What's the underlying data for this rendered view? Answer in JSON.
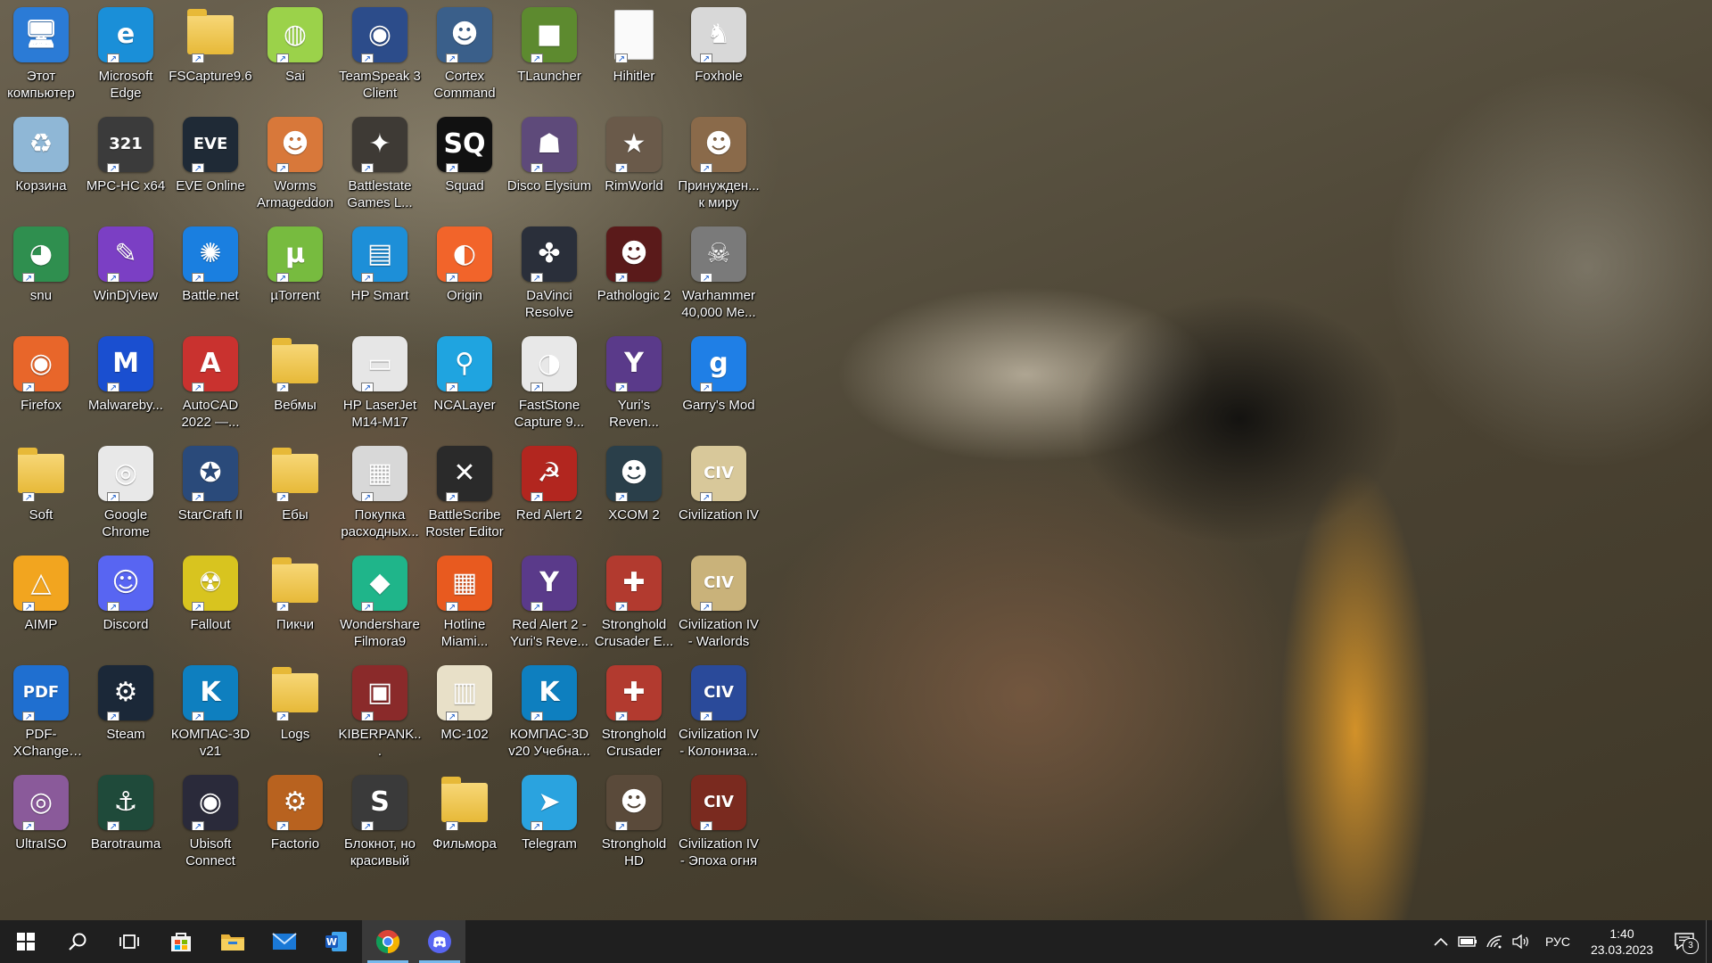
{
  "desktop": {
    "icons": [
      {
        "label": "Этот компьютер",
        "icon": "this-pc-icon",
        "color": "#2b7bd6",
        "glyph": "🖥",
        "shortcut": false
      },
      {
        "label": "Microsoft Edge",
        "icon": "edge-icon",
        "color": "#1a8fd8",
        "glyph": "e",
        "shortcut": true
      },
      {
        "label": "FSCapture9.6",
        "icon": "folder-icon",
        "color": "#e7b938",
        "glyph": "",
        "shortcut": true,
        "folder": true
      },
      {
        "label": "Sai",
        "icon": "sai-icon",
        "color": "#9bd24a",
        "glyph": "◍",
        "shortcut": true
      },
      {
        "label": "TeamSpeak 3 Client",
        "icon": "teamspeak-icon",
        "color": "#2c4c8a",
        "glyph": "◉",
        "shortcut": true
      },
      {
        "label": "Cortex Command",
        "icon": "cortex-command-icon",
        "color": "#3a5f8a",
        "glyph": "☻",
        "shortcut": true
      },
      {
        "label": "TLauncher",
        "icon": "tlauncher-icon",
        "color": "#5d8a2f",
        "glyph": "■",
        "shortcut": true
      },
      {
        "label": "Hihitler",
        "icon": "document-icon",
        "color": "#f2f2f2",
        "glyph": "",
        "shortcut": true,
        "doc": true
      },
      {
        "label": "Foxhole",
        "icon": "foxhole-icon",
        "color": "#d8d8d8",
        "glyph": "♞",
        "shortcut": true
      },
      {
        "label": "Корзина",
        "icon": "recycle-bin-icon",
        "color": "#8fb7d6",
        "glyph": "♻",
        "shortcut": false
      },
      {
        "label": "MPC-HC x64",
        "icon": "mpc-hc-icon",
        "color": "#3b3b3b",
        "glyph": "321",
        "shortcut": true
      },
      {
        "label": "EVE Online",
        "icon": "eve-online-icon",
        "color": "#1f2a36",
        "glyph": "EVE",
        "shortcut": true
      },
      {
        "label": "Worms Armageddon",
        "icon": "worms-icon",
        "color": "#d8783a",
        "glyph": "☻",
        "shortcut": true
      },
      {
        "label": "Battlestate Games L...",
        "icon": "battlestate-icon",
        "color": "#3e3a35",
        "glyph": "✦",
        "shortcut": true
      },
      {
        "label": "Squad",
        "icon": "squad-icon",
        "color": "#111111",
        "glyph": "SQ",
        "shortcut": true
      },
      {
        "label": "Disco Elysium",
        "icon": "disco-elysium-icon",
        "color": "#5e4a7a",
        "glyph": "☗",
        "shortcut": true
      },
      {
        "label": "RimWorld",
        "icon": "rimworld-icon",
        "color": "#6a5a4a",
        "glyph": "★",
        "shortcut": true
      },
      {
        "label": "Принужден... к миру",
        "icon": "game-icon",
        "color": "#8a6a4a",
        "glyph": "☻",
        "shortcut": true
      },
      {
        "label": "snu",
        "icon": "snu-icon",
        "color": "#2f8f4f",
        "glyph": "◕",
        "shortcut": true
      },
      {
        "label": "WinDjView",
        "icon": "windjview-icon",
        "color": "#7b3fc4",
        "glyph": "✎",
        "shortcut": true
      },
      {
        "label": "Battle.net",
        "icon": "battlenet-icon",
        "color": "#1a7fe0",
        "glyph": "✺",
        "shortcut": true
      },
      {
        "label": "µTorrent",
        "icon": "utorrent-icon",
        "color": "#77bb3f",
        "glyph": "µ",
        "shortcut": true
      },
      {
        "label": "HP Smart",
        "icon": "hp-smart-icon",
        "color": "#1d8fd8",
        "glyph": "▤",
        "shortcut": true
      },
      {
        "label": "Origin",
        "icon": "origin-icon",
        "color": "#f2642a",
        "glyph": "◐",
        "shortcut": true
      },
      {
        "label": "DaVinci Resolve",
        "icon": "davinci-resolve-icon",
        "color": "#2a2f3a",
        "glyph": "✤",
        "shortcut": true
      },
      {
        "label": "Pathologic 2",
        "icon": "pathologic-icon",
        "color": "#5a1a1a",
        "glyph": "☻",
        "shortcut": true
      },
      {
        "label": "Warhammer 40,000 Me...",
        "icon": "warhammer-icon",
        "color": "#7a7a7a",
        "glyph": "☠",
        "shortcut": true
      },
      {
        "label": "Firefox",
        "icon": "firefox-icon",
        "color": "#e8662a",
        "glyph": "◉",
        "shortcut": true
      },
      {
        "label": "Malwareby...",
        "icon": "malwarebytes-icon",
        "color": "#1a4fd0",
        "glyph": "M",
        "shortcut": true
      },
      {
        "label": "AutoCAD 2022 —...",
        "icon": "autocad-icon",
        "color": "#c9322f",
        "glyph": "A",
        "shortcut": true
      },
      {
        "label": "Вебмы",
        "icon": "folder-icon",
        "color": "#e7b938",
        "glyph": "",
        "shortcut": true,
        "folder": true
      },
      {
        "label": "HP LaserJet M14-M17",
        "icon": "printer-icon",
        "color": "#e6e6e6",
        "glyph": "▭",
        "shortcut": true
      },
      {
        "label": "NCALayer",
        "icon": "ncalayer-icon",
        "color": "#1fa4e0",
        "glyph": "⚲",
        "shortcut": true
      },
      {
        "label": "FastStone Capture 9...",
        "icon": "faststone-icon",
        "color": "#e8e8e8",
        "glyph": "◑",
        "shortcut": true
      },
      {
        "label": "Yuri's Reven...",
        "icon": "yuris-revenge-icon",
        "color": "#5a3a8a",
        "glyph": "Y",
        "shortcut": true
      },
      {
        "label": "Garry's Mod",
        "icon": "garrys-mod-icon",
        "color": "#1f7fe6",
        "glyph": "g",
        "shortcut": true
      },
      {
        "label": "Soft",
        "icon": "folder-icon",
        "color": "#e7b938",
        "glyph": "",
        "shortcut": true,
        "folder": true
      },
      {
        "label": "Google Chrome",
        "icon": "chrome-icon",
        "color": "#e8e8e8",
        "glyph": "◎",
        "shortcut": true
      },
      {
        "label": "StarCraft II",
        "icon": "starcraft-icon",
        "color": "#2a4a7a",
        "glyph": "✪",
        "shortcut": true
      },
      {
        "label": "Ебы",
        "icon": "folder-icon",
        "color": "#e7b938",
        "glyph": "",
        "shortcut": true,
        "folder": true
      },
      {
        "label": "Покупка расходных...",
        "icon": "printer-ink-icon",
        "color": "#d8d8d8",
        "glyph": "▦",
        "shortcut": true
      },
      {
        "label": "BattleScribe Roster Editor",
        "icon": "battlescribe-icon",
        "color": "#2a2a2a",
        "glyph": "✕",
        "shortcut": true
      },
      {
        "label": "Red Alert 2",
        "icon": "red-alert-icon",
        "color": "#b2261f",
        "glyph": "☭",
        "shortcut": true
      },
      {
        "label": "XCOM 2",
        "icon": "xcom-icon",
        "color": "#2a3f4a",
        "glyph": "☻",
        "shortcut": true
      },
      {
        "label": "Civilization IV",
        "icon": "civilization-icon",
        "color": "#d8c89a",
        "glyph": "CIV",
        "shortcut": true
      },
      {
        "label": "AIMP",
        "icon": "aimp-icon",
        "color": "#f2a51f",
        "glyph": "△",
        "shortcut": true
      },
      {
        "label": "Discord",
        "icon": "discord-icon",
        "color": "#5865f2",
        "glyph": "☺",
        "shortcut": true
      },
      {
        "label": "Fallout",
        "icon": "fallout-icon",
        "color": "#d8c41f",
        "glyph": "☢",
        "shortcut": true
      },
      {
        "label": "Пикчи",
        "icon": "folder-icon",
        "color": "#e7b938",
        "glyph": "",
        "shortcut": true,
        "folder": true
      },
      {
        "label": "Wondershare Filmora9",
        "icon": "filmora-icon",
        "color": "#1fb58a",
        "glyph": "◆",
        "shortcut": true
      },
      {
        "label": "Hotline Miami...",
        "icon": "hotline-miami-icon",
        "color": "#e85a1f",
        "glyph": "▦",
        "shortcut": true
      },
      {
        "label": "Red Alert 2 - Yuri's Reve...",
        "icon": "yuris-revenge-icon",
        "color": "#5a3a8a",
        "glyph": "Y",
        "shortcut": true
      },
      {
        "label": "Stronghold Crusader E...",
        "icon": "stronghold-icon",
        "color": "#b23a2f",
        "glyph": "✚",
        "shortcut": true
      },
      {
        "label": "Civilization IV - Warlords",
        "icon": "civilization-icon",
        "color": "#c9b27a",
        "glyph": "CIV",
        "shortcut": true
      },
      {
        "label": "PDF-XChange Viewer",
        "icon": "pdf-xchange-icon",
        "color": "#1f6fd0",
        "glyph": "PDF",
        "shortcut": true
      },
      {
        "label": "Steam",
        "icon": "steam-icon",
        "color": "#1b2838",
        "glyph": "⚙",
        "shortcut": true
      },
      {
        "label": "КОМПАС-3D v21",
        "icon": "kompas-icon",
        "color": "#0e7fbf",
        "glyph": "K",
        "shortcut": true
      },
      {
        "label": "Logs",
        "icon": "folder-icon",
        "color": "#e7b938",
        "glyph": "",
        "shortcut": true,
        "folder": true
      },
      {
        "label": "KIBERPANK...",
        "icon": "cyberpunk-icon",
        "color": "#8a2a2a",
        "glyph": "▣",
        "shortcut": true
      },
      {
        "label": "MC-102",
        "icon": "archive-icon",
        "color": "#e8e0c8",
        "glyph": "▥",
        "shortcut": true
      },
      {
        "label": "КОМПАС-3D v20 Учебна...",
        "icon": "kompas-icon",
        "color": "#0e7fbf",
        "glyph": "K",
        "shortcut": true
      },
      {
        "label": "Stronghold Crusader",
        "icon": "stronghold-icon",
        "color": "#b23a2f",
        "glyph": "✚",
        "shortcut": true
      },
      {
        "label": "Civilization IV - Колониза...",
        "icon": "civilization-icon",
        "color": "#2a4a9a",
        "glyph": "CIV",
        "shortcut": true
      },
      {
        "label": "UltraISO",
        "icon": "ultraiso-icon",
        "color": "#8a5a9a",
        "glyph": "◎",
        "shortcut": true
      },
      {
        "label": "Barotrauma",
        "icon": "barotrauma-icon",
        "color": "#1f4a3a",
        "glyph": "⚓",
        "shortcut": true
      },
      {
        "label": "Ubisoft Connect",
        "icon": "ubisoft-icon",
        "color": "#2a2a3a",
        "glyph": "◉",
        "shortcut": true
      },
      {
        "label": "Factorio",
        "icon": "factorio-icon",
        "color": "#b8621f",
        "glyph": "⚙",
        "shortcut": true
      },
      {
        "label": "Блокнот, но красивый",
        "icon": "sublime-icon",
        "color": "#3a3a3a",
        "glyph": "S",
        "shortcut": true
      },
      {
        "label": "Фильмора",
        "icon": "folder-icon",
        "color": "#e7b938",
        "glyph": "",
        "shortcut": true,
        "folder": true
      },
      {
        "label": "Telegram",
        "icon": "telegram-icon",
        "color": "#2aa3df",
        "glyph": "➤",
        "shortcut": true
      },
      {
        "label": "Stronghold HD",
        "icon": "stronghold-icon",
        "color": "#5a4a3a",
        "glyph": "☻",
        "shortcut": true
      },
      {
        "label": "Civilization IV - Эпоха огня",
        "icon": "civilization-icon",
        "color": "#7a2a1f",
        "glyph": "CIV",
        "shortcut": true
      }
    ]
  },
  "taskbar": {
    "start": {
      "icon": "windows-start-icon"
    },
    "search": {
      "icon": "search-icon"
    },
    "task_view": {
      "icon": "task-view-icon"
    },
    "pinned": [
      {
        "name": "microsoft-store",
        "icon": "store-icon",
        "active": false
      },
      {
        "name": "file-explorer",
        "icon": "file-explorer-icon",
        "active": false
      },
      {
        "name": "mail",
        "icon": "mail-icon",
        "active": false
      },
      {
        "name": "word",
        "icon": "word-icon",
        "active": false
      },
      {
        "name": "chrome",
        "icon": "chrome-icon",
        "active": true
      },
      {
        "name": "discord",
        "icon": "discord-icon",
        "active": true
      }
    ],
    "tray": {
      "language": "РУС",
      "time": "1:40",
      "date": "23.03.2023",
      "notifications_count": "3"
    }
  }
}
